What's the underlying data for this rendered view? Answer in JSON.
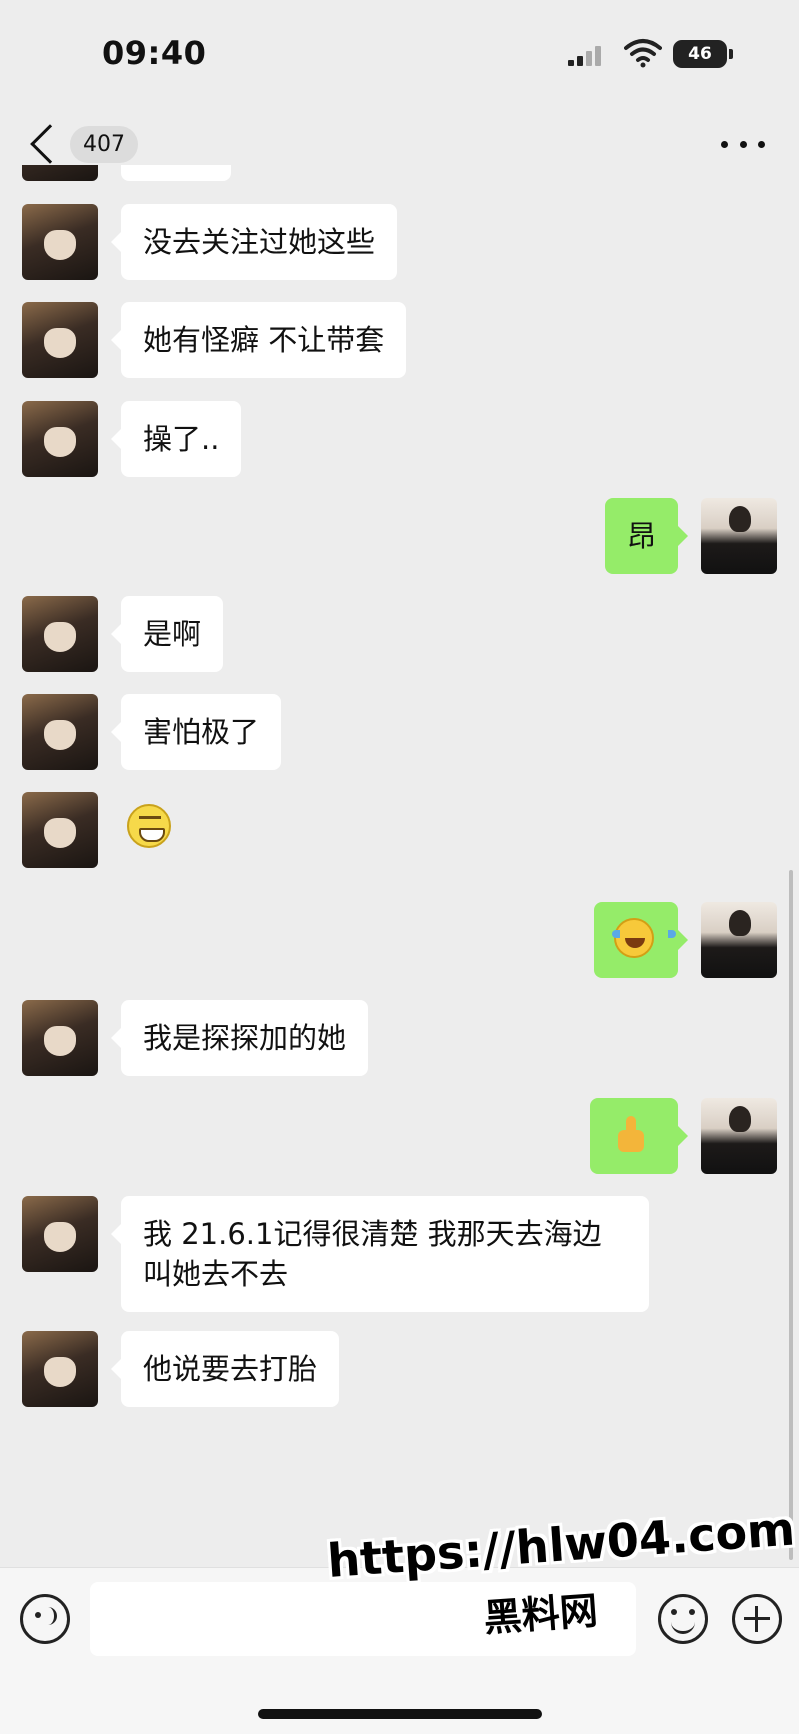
{
  "status_bar": {
    "time": "09:40",
    "battery": "46"
  },
  "nav": {
    "unread_count": "407"
  },
  "messages": [
    {
      "side": "left",
      "type": "text",
      "text": "没去关注过她这些"
    },
    {
      "side": "left",
      "type": "text",
      "text": "她有怪癖 不让带套"
    },
    {
      "side": "left",
      "type": "text",
      "text": "操了.."
    },
    {
      "side": "right",
      "type": "text",
      "text": "昂"
    },
    {
      "side": "left",
      "type": "text",
      "text": "是啊"
    },
    {
      "side": "left",
      "type": "text",
      "text": "害怕极了"
    },
    {
      "side": "left",
      "type": "emoji",
      "emoji": "grin-emoji"
    },
    {
      "side": "right",
      "type": "emoji",
      "emoji": "laugh-cry-emoji"
    },
    {
      "side": "left",
      "type": "text",
      "text": "我是探探加的她"
    },
    {
      "side": "right",
      "type": "emoji",
      "emoji": "thumbs-up-emoji"
    },
    {
      "side": "left",
      "type": "text",
      "text": "我 21.6.1记得很清楚 我那天去海边叫她去不去"
    },
    {
      "side": "left",
      "type": "text",
      "text": "他说要去打胎"
    }
  ],
  "watermark": {
    "url": "https://hlw04.com",
    "name": "黑料网"
  },
  "colors": {
    "background": "#ededed",
    "sent_bubble": "#95ec69",
    "received_bubble": "#ffffff"
  }
}
